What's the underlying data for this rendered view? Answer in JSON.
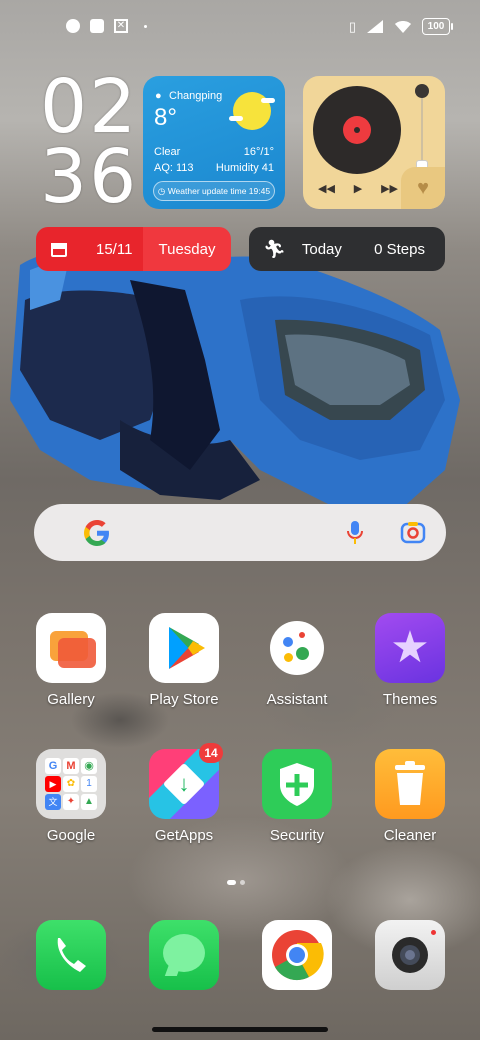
{
  "status_bar": {
    "battery": "100",
    "left_icons": [
      "notification-icon",
      "square-icon",
      "crossed-icon",
      "dot-icon"
    ],
    "right_icons": [
      "vibrate-icon",
      "signal-icon",
      "wifi-icon",
      "battery-icon"
    ]
  },
  "clock": {
    "hours": "02",
    "minutes": "36"
  },
  "weather": {
    "city": "Changping",
    "temperature": "8°",
    "condition": "Clear",
    "range": "16°/1°",
    "aq": "AQ: 113",
    "humidity": "Humidity 41",
    "update": "Weather update time 19:45"
  },
  "date_widget": {
    "date": "15/11",
    "weekday": "Tuesday"
  },
  "steps_widget": {
    "label": "Today",
    "steps": "0 Steps"
  },
  "apps": [
    {
      "label": "Gallery"
    },
    {
      "label": "Play Store"
    },
    {
      "label": "Assistant"
    },
    {
      "label": "Themes"
    },
    {
      "label": "Google"
    },
    {
      "label": "GetApps",
      "badge": "14"
    },
    {
      "label": "Security"
    },
    {
      "label": "Cleaner"
    }
  ],
  "dock": [
    "phone-icon",
    "messages-icon",
    "chrome-icon",
    "camera-icon"
  ],
  "colors": {
    "accent_red": "#e8252c",
    "weather_blue": "#1b87cf",
    "music_bg": "#f1d699"
  }
}
